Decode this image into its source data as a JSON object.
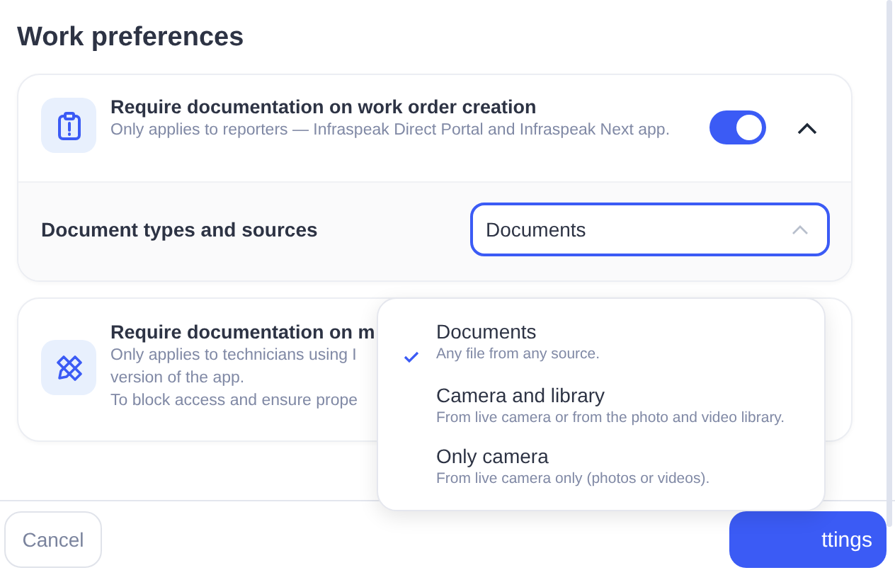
{
  "title": "Work preferences",
  "cards": [
    {
      "title": "Require documentation on work order creation",
      "description": [
        "Only applies to reporters — Infraspeak Direct Portal and Infraspeak Next app."
      ],
      "toggle": {
        "on": true
      },
      "expanded": true,
      "setting": {
        "label": "Document types and sources",
        "value": "Documents",
        "open": true
      }
    },
    {
      "title": "Require documentation on m",
      "description": [
        "Only applies to technicians using I",
        "version of the app.",
        "To block access and ensure prope"
      ]
    }
  ],
  "menu": [
    {
      "label": "Documents",
      "hint": "Any file from any source.",
      "selected": true
    },
    {
      "label": "Camera and library",
      "hint": "From live camera or from the photo and video library.",
      "selected": false
    },
    {
      "label": "Only camera",
      "hint": "From live camera only (photos or videos).",
      "selected": false
    }
  ],
  "footer": {
    "cancel": "Cancel",
    "save": "ttings"
  }
}
